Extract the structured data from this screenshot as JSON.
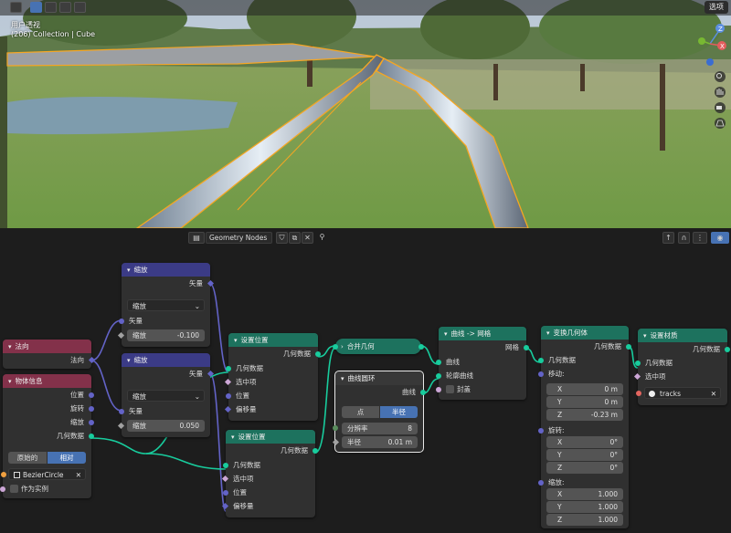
{
  "viewport": {
    "view_name": "用户透视",
    "collection_info": "(206) Collection | Cube",
    "options_label": "选项",
    "gizmo_x": "X",
    "gizmo_y": "Y",
    "gizmo_z": "Z"
  },
  "node_editor": {
    "tree_name": "Geometry Nodes"
  },
  "nodes": {
    "scale1": {
      "title": "缩放",
      "output": "矢量",
      "mode": "缩放",
      "input_vector": "矢量",
      "scale_label": "缩放",
      "scale_value": "-0.100"
    },
    "scale2": {
      "title": "缩放",
      "output": "矢量",
      "mode": "缩放",
      "input_vector": "矢量",
      "scale_label": "缩放",
      "scale_value": "0.050"
    },
    "normal": {
      "title": "法向",
      "output": "法向"
    },
    "object_info": {
      "title": "物体信息",
      "out_location": "位置",
      "out_rotation": "旋转",
      "out_scale": "缩放",
      "out_geometry": "几何数据",
      "btn_original": "原始的",
      "btn_relative": "相对",
      "object": "BezierCircle",
      "as_instance": "作为实例"
    },
    "set_pos1": {
      "title": "设置位置",
      "output": "几何数据",
      "in_geometry": "几何数据",
      "in_selection": "选中项",
      "in_position": "位置",
      "in_offset": "偏移量"
    },
    "set_pos2": {
      "title": "设置位置",
      "output": "几何数据",
      "in_geometry": "几何数据",
      "in_selection": "选中项",
      "in_position": "位置",
      "in_offset": "偏移量"
    },
    "join": {
      "title": "合并几何"
    },
    "curve_circle": {
      "title": "曲线圆环",
      "output": "曲线",
      "mode_point": "点",
      "mode_radius": "半径",
      "resolution_label": "分辨率",
      "resolution_value": "8",
      "radius_label": "半径",
      "radius_value": "0.01 m"
    },
    "curve_to_mesh": {
      "title": "曲线 -> 网格",
      "output": "网格",
      "in_curve": "曲线",
      "in_profile": "轮廓曲线",
      "in_fill": "封盖"
    },
    "transform": {
      "title": "变换几何体",
      "output": "几何数据",
      "in_geometry": "几何数据",
      "translate_label": "移动:",
      "tx": "0 m",
      "ty": "0 m",
      "tz": "-0.23 m",
      "rotate_label": "旋转:",
      "rx": "0°",
      "ry": "0°",
      "rz": "0°",
      "scale_label": "缩放:",
      "sx": "1.000",
      "sy": "1.000",
      "sz": "1.000",
      "axis_x": "X",
      "axis_y": "Y",
      "axis_z": "Z"
    },
    "set_material": {
      "title": "设置材质",
      "output": "几何数据",
      "in_geometry": "几何数据",
      "in_selection": "选中项",
      "material": "tracks"
    }
  },
  "colors": {
    "geometry_socket": "#18cc9d",
    "vector_socket": "#6363c7",
    "header_vector": "#3b3b86",
    "header_input": "#83314a",
    "header_geometry": "#1d725e",
    "selected_accent": "#4772b3",
    "selection_outline": "#f5a623"
  }
}
